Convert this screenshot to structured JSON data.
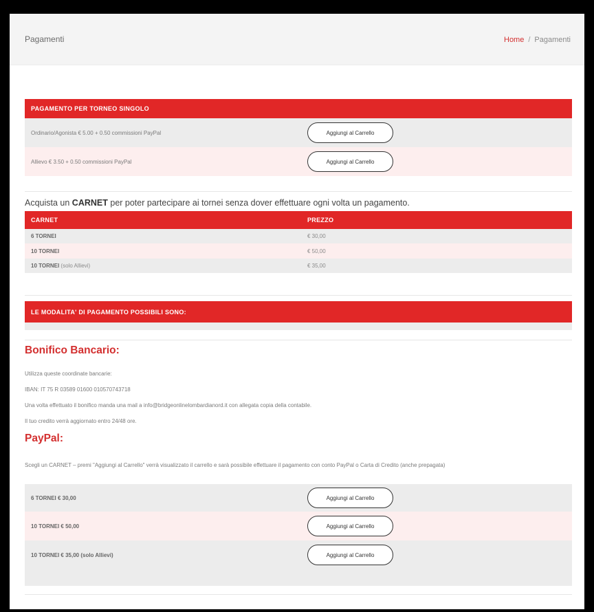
{
  "header": {
    "page_title": "Pagamenti",
    "breadcrumb_home": "Home",
    "breadcrumb_separator": "/",
    "breadcrumb_current": "Pagamenti"
  },
  "single": {
    "heading": "PAGAMENTO PER TORNEO SINGOLO",
    "rows": [
      {
        "label": "Ordinario/Agonista € 5.00 + 0.50 commissioni PayPal",
        "button": "Aggiungi al Carrello"
      },
      {
        "label": "Allievo € 3.50 + 0.50 commissioni PayPal",
        "button": "Aggiungi al Carrello"
      }
    ]
  },
  "carnet_intro": {
    "before": "Acquista un ",
    "bold": "CARNET",
    "after": " per poter partecipare ai tornei senza dover effettuare ogni volta un pagamento."
  },
  "carnet_table": {
    "headers": [
      "CARNET",
      "PREZZO"
    ],
    "rows": [
      {
        "name": "6 TORNEI",
        "note": "",
        "price": "€ 30,00"
      },
      {
        "name": "10 TORNEI",
        "note": "",
        "price": "€ 50,00"
      },
      {
        "name": "10 TORNEI",
        "note": " (solo Allievi)",
        "price": "€ 35,00"
      }
    ]
  },
  "modalita": {
    "heading": "LE MODALITA' DI PAGAMENTO POSSIBILI SONO:"
  },
  "bonifico": {
    "title": "Bonifico Bancario:",
    "lines": [
      "Utilizza queste coordinate bancarie:",
      "IBAN: IT 75 R 03589 01600 010570743718",
      "Una volta effettuato il bonifico manda una mail a info@bridgeonlinelombardianord.it con allegata copia della contabile.",
      "Il tuo credito verrà aggiornato entro 24/48 ore."
    ]
  },
  "paypal": {
    "title": "PayPal:",
    "description": "Scegli un CARNET – premi \"Aggiungi al Carrello\" verrà visualizzato il carrello e sarà possibile effettuare il pagamento con conto PayPal o Carta di Credito (anche prepagata)",
    "rows": [
      {
        "label": "6 TORNEI € 30,00",
        "button": "Aggiungi al Carrello"
      },
      {
        "label": "10 TORNEI € 50,00",
        "button": "Aggiungi al Carrello"
      },
      {
        "label": "10 TORNEI € 35,00 (solo Allievi)",
        "button": "Aggiungi al Carrello"
      }
    ]
  },
  "colors": {
    "accent_red": "#e12727",
    "heading_red": "#d32f2f",
    "row_grey": "#ececec",
    "row_pink": "#fdeeee"
  }
}
